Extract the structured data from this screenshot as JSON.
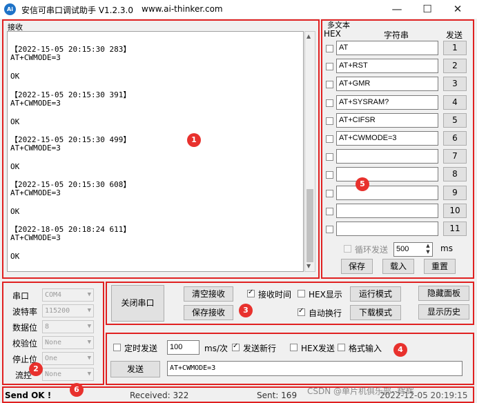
{
  "window": {
    "title": "安信可串口调试助手 V1.2.3.0",
    "url": "www.ai-thinker.com",
    "icon_text": "Ai",
    "minimize_icon": "minimize-icon",
    "maximize_icon": "maximize-icon",
    "close_icon": "close-icon"
  },
  "receive": {
    "label": "接收",
    "lines": [
      "【2022-15-05 20:15:30 283】",
      "AT+CWMODE=3",
      "",
      "OK",
      "",
      "【2022-15-05 20:15:30 391】",
      "AT+CWMODE=3",
      "",
      "OK",
      "",
      "【2022-15-05 20:15:30 499】",
      "AT+CWMODE=3",
      "",
      "OK",
      "",
      "【2022-15-05 20:15:30 608】",
      "AT+CWMODE=3",
      "",
      "OK",
      "",
      "【2022-18-05 20:18:24 611】",
      "AT+CWMODE=3",
      "",
      "OK"
    ]
  },
  "multi": {
    "label": "多文本",
    "hex_header": "HEX",
    "string_header": "字符串",
    "send_header": "发送",
    "rows": [
      {
        "text": "AT",
        "num": "1"
      },
      {
        "text": "AT+RST",
        "num": "2"
      },
      {
        "text": "AT+GMR",
        "num": "3"
      },
      {
        "text": "AT+SYSRAM?",
        "num": "4"
      },
      {
        "text": "AT+CIFSR",
        "num": "5"
      },
      {
        "text": "AT+CWMODE=3",
        "num": "6"
      },
      {
        "text": "",
        "num": "7"
      },
      {
        "text": "",
        "num": "8"
      },
      {
        "text": "",
        "num": "9"
      },
      {
        "text": "",
        "num": "10"
      },
      {
        "text": "",
        "num": "11"
      }
    ],
    "loop_label": "循环发送",
    "loop_interval": "500",
    "ms_label": "ms",
    "save_btn": "保存",
    "load_btn": "载入",
    "reset_btn": "重置"
  },
  "port": {
    "port_label": "串口",
    "port_value": "COM4",
    "baud_label": "波特率",
    "baud_value": "115200",
    "data_label": "数据位",
    "data_value": "8",
    "parity_label": "校验位",
    "parity_value": "None",
    "stop_label": "停止位",
    "stop_value": "One",
    "flow_label": "流控",
    "flow_value": "None"
  },
  "controls": {
    "close_port": "关闭串口",
    "clear_recv": "清空接收",
    "save_recv": "保存接收",
    "recv_time": "接收时间",
    "hex_display": "HEX显示",
    "auto_newline": "自动换行",
    "run_mode": "运行模式",
    "download_mode": "下载模式",
    "hide_panel": "隐藏面板",
    "show_history": "显示历史"
  },
  "send": {
    "timed_send": "定时发送",
    "interval": "100",
    "unit": "ms/次",
    "send_newline": "发送新行",
    "hex_send": "HEX发送",
    "format_input": "格式输入",
    "send_btn": "发送",
    "input_value": "AT+CWMODE=3"
  },
  "status": {
    "message": "Send OK !",
    "received_label": "Received: 322",
    "sent_label": "Sent: 169",
    "datetime": "2022-12-05 20:19:15"
  },
  "watermark": "CSDN @单片机俱乐部--辉辉",
  "markers": [
    "1",
    "2",
    "3",
    "4",
    "5",
    "6"
  ],
  "colors": {
    "annotation_red": "#e02020",
    "marker_red": "#e8312d",
    "accent_blue": "#1e73c8"
  }
}
